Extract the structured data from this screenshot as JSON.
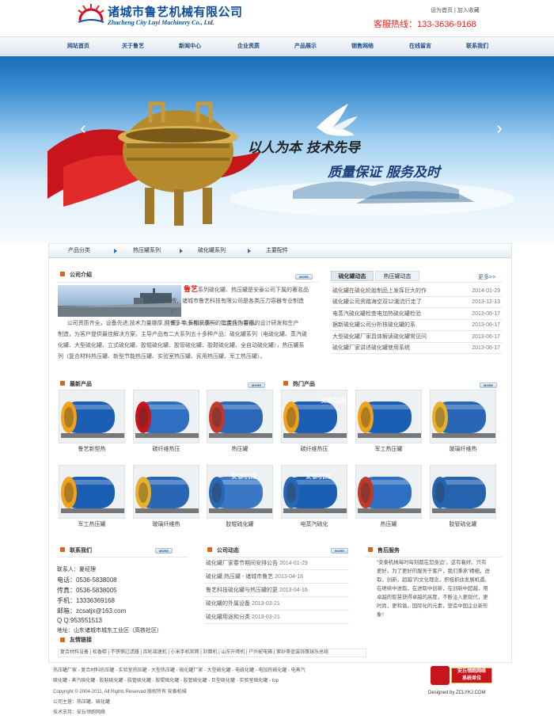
{
  "header": {
    "company_cn": "诸城市鲁艺机械有限公司",
    "company_en": "Zhucheng City Luyi Machinery Co., Ltd.",
    "set_home": "设为首页",
    "separator": "|",
    "add_favorite": "加入收藏",
    "hotline_label": "客服热线：",
    "hotline_number": "133-3636-9168"
  },
  "nav": [
    "网站首页",
    "关于鲁艺",
    "新闻中心",
    "企业资质",
    "产品展示",
    "销售网络",
    "在线留言",
    "联系我们"
  ],
  "banner": {
    "slogan_1": "以人为本 技术先导",
    "slogan_2": "质量保证 服务及时"
  },
  "tabs": {
    "label_1": "产品分类",
    "label_2": "热压罐系列",
    "label_3": "硫化罐系列",
    "label_4": "主要配件"
  },
  "company_intro": {
    "title": "公司介绍",
    "more": "MORE",
    "brand": "鲁艺",
    "text_1": "系列硫化罐、热压罐是安泰公司下属的著名品",
    "text_2": "牌，诸城市鲁艺科技有限公司是各类压力容器专业制造厂",
    "text_3": "家，众多标识获照的指定合作单位。",
    "text_4": "公司资质齐全，设备先进,技术力量雄厚,拥有多年,长期从事一、二类压力容器的设计研发和生产",
    "text_5": "制造，为客户提供最佳解决方案，主导产品有二大系列五十多种产品：硫化罐系列（电硫化罐、蒸汽硫",
    "text_6": "化罐、大型硫化罐、立式硫化罐、胶辊硫化罐、胶管硫化罐、胶鞋硫化罐、全自动硫化罐），热压罐系",
    "text_7": "列（复合材料热压罐、新型节能热压罐、实验室热压罐、民用热压罐、军工热压罐）。"
  },
  "news_tabs": {
    "tab_1": "硫化罐动态",
    "tab_2": "热压罐动态",
    "more": "更多>>"
  },
  "news": [
    {
      "title": "硫化罐在硫化轮胎制品上发挥巨大的作",
      "date": "2014-01-29"
    },
    {
      "title": "硫化罐公司资踏海空双12潮流行走了",
      "date": "2013-12-13"
    },
    {
      "title": "电蒸汽硫化罐检查电加热硫化罐检验",
      "date": "2013-06-17"
    },
    {
      "title": "据新硫化罐公司分析核硫化罐的系",
      "date": "2013-06-17"
    },
    {
      "title": "大型硫化罐厂家具体解读硫化罐常见问",
      "date": "2013-06-17"
    },
    {
      "title": "硫化罐厂家讲述硫化罐使用系统",
      "date": "2013-06-17"
    }
  ],
  "new_products": {
    "title": "最新产品",
    "more": "MORE"
  },
  "hot_products": {
    "title": "热门产品",
    "more": "MORE"
  },
  "products_row1": [
    "鲁艺新型热",
    "碳纤维热压",
    "热压罐",
    "碳纤维热压",
    "军工热压罐",
    "玻璃纤维热"
  ],
  "products_row2": [
    "军工热压罐",
    "玻璃纤维热",
    "胶辊硫化罐",
    "电蒸汽硫化",
    "热压罐",
    "胶管硫化罐"
  ],
  "product_watermark": "安泰机械",
  "contact": {
    "title": "联系我们",
    "more": "MORE",
    "person_label": "联系人：",
    "person": "夏经理",
    "phone_label": "电话：",
    "phone": "0536-5838008",
    "fax_label": "传真：",
    "fax": "0536-5838005",
    "mobile_label": "手机：",
    "mobile": "13336369168",
    "email_label": "邮箱：",
    "email": "zcsatjx@163.com",
    "qq_label": "Q Q:",
    "qq": "953551513",
    "address_label": "地址：",
    "address": "山东诸城市城东工业区（高铁社区）"
  },
  "company_news": {
    "title": "公司动态",
    "more": "MORE",
    "items": [
      {
        "title": "硫化罐厂家春节期间安排公告",
        "date": "2014-01-29"
      },
      {
        "title": "硫化罐,热压罐 - 诸城市鲁艺",
        "date": "2013-04-16"
      },
      {
        "title": "鲁艺科技硫化罐与热压罐的更",
        "date": "2013-04-16"
      },
      {
        "title": "硫化罐的外属设备",
        "date": "2013-03-21"
      },
      {
        "title": "硫化罐用途和分类",
        "date": "2013-03-21"
      }
    ]
  },
  "after_sales": {
    "title": "售后服务",
    "line_1": "“安泰机械每时每刻都在您身边”。这有着好。只有",
    "line_2": "更好。为了更好的服务于客户，我们秉承“精细，进",
    "line_3": "取，创新，超越”的文化理念，积极抓住发展机遇。",
    "line_4": "在继续中进取，在进取中创新，在创新中超越，用",
    "line_5": "卓越的智慧获得卓越的高度，不断注入更现代，更",
    "line_6": "时尚，更和谐，国际化的元素，塑造中国企业新形",
    "line_7": "象！"
  },
  "friend_links": {
    "title": "友情链接",
    "items": "复合材料设备 | 松香碳 | 不锈钢过滤器 | 齿轮减速机 | 小米手机官网 | 封面机 | 山东升降机 | 户外配电箱 | 紫砂茶壶装饰簇球乐总统"
  },
  "footer": {
    "line_1": "热压罐厂家 - 复合材料热压罐 - 实验室热压罐 - 大型热压罐 - 硫化罐厂家 - 大型硫化罐 - 电硫化罐 - 电加热硫化罐 - 电蒸汽",
    "line_2": "硫化罐 - 蒸汽硫化罐 - 胶鞋硫化罐 - 胶管硫化罐 - 胶辊硫化罐 - 胶管硫化罐 - 巨型硫化罐 - 实验室硫化罐 - top",
    "line_3": "Copyright © 2004-2011, All Rights Reserved.版权所有 安泰机械",
    "line_4": "公司主营：热压罐、硫化罐",
    "line_5": "技术支持：安丘领跑网络",
    "designer_logo_cn": "安丘领跑网络",
    "designer_logo_sub": "系统单位",
    "designer_text": "Designed by ZCLYKJ.COM"
  },
  "colors": {
    "brand_blue": "#0b4f9c",
    "accent_red": "#e2261c",
    "nav_text": "#1f4d8a"
  }
}
